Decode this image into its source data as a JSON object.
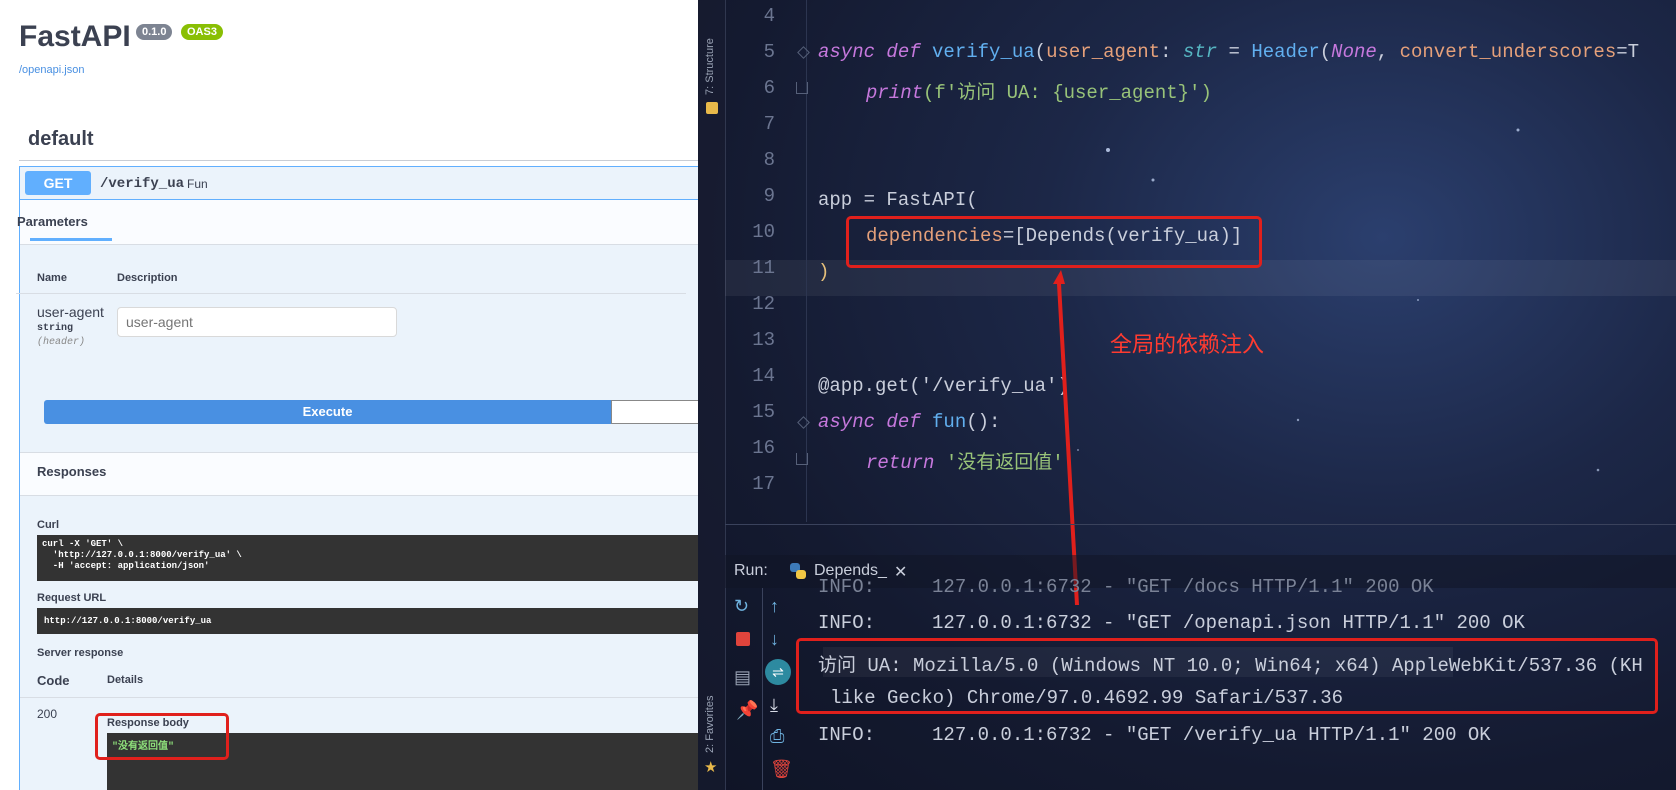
{
  "swagger": {
    "title": "FastAPI",
    "version_badge": "0.1.0",
    "oas_badge": "OAS3",
    "spec_link": "/openapi.json",
    "tag": "default",
    "operation": {
      "method": "GET",
      "path": "/verify_ua",
      "summary": "Fun"
    },
    "parameters_tab": "Parameters",
    "col_name": "Name",
    "col_description": "Description",
    "param": {
      "name": "user-agent",
      "type": "string",
      "in": "(header)",
      "placeholder": "user-agent"
    },
    "execute_label": "Execute",
    "responses_title": "Responses",
    "curl_label": "Curl",
    "curl_command": "curl -X 'GET' \\\n  'http://127.0.0.1:8000/verify_ua' \\\n  -H 'accept: application/json'",
    "request_url_label": "Request URL",
    "request_url": "http://127.0.0.1:8000/verify_ua",
    "server_response_label": "Server response",
    "code_header": "Code",
    "details_header": "Details",
    "status_code": "200",
    "response_body_label": "Response body",
    "response_body": "\"没有返回值\""
  },
  "ide": {
    "structure_label": "7: Structure",
    "favorites_label": "2: Favorites",
    "annotation": "全局的依赖注入",
    "code_lines": [
      {
        "n": "4"
      },
      {
        "n": "5"
      },
      {
        "n": "6"
      },
      {
        "n": "7"
      },
      {
        "n": "8"
      },
      {
        "n": "9"
      },
      {
        "n": "10"
      },
      {
        "n": "11"
      },
      {
        "n": "12"
      },
      {
        "n": "13"
      },
      {
        "n": "14"
      },
      {
        "n": "15"
      },
      {
        "n": "16"
      },
      {
        "n": "17"
      }
    ],
    "code": {
      "l5_async": "async def",
      "l5_fn": "verify_ua",
      "l5_open": "(",
      "l5_param": "user_agent",
      "l5_colon": ": ",
      "l5_type": "str",
      "l5_eq": " = ",
      "l5_header": "Header",
      "l5_paren": "(",
      "l5_none": "None",
      "l5_comma": ", ",
      "l5_conv": "convert_underscores",
      "l5_tail": "=T",
      "l6_print": "print",
      "l6_str": "(f'访问 UA: {user_agent}')",
      "l9": "app = FastAPI(",
      "l10_dep": "dependencies",
      "l10_rest": "=[Depends(verify_ua)]",
      "l11": ")",
      "l14": "@app.get('/verify_ua')",
      "l15_async": "async def",
      "l15_fn": "fun",
      "l15_rest": "():",
      "l16_return": "return",
      "l16_str": "'没有返回值'"
    },
    "run": {
      "label": "Run:",
      "tab": "Depends_",
      "close": "✕",
      "log0": "INFO:     127.0.0.1:6732 - \"GET /docs HTTP/1.1\" 200 OK",
      "log1": "INFO:     127.0.0.1:6732 - \"GET /openapi.json HTTP/1.1\" 200 OK",
      "log2": "访问 UA: Mozilla/5.0 (Windows NT 10.0; Win64; x64) AppleWebKit/537.36 (KH",
      "log3": "like Gecko) Chrome/97.0.4692.99 Safari/537.36",
      "log4": "INFO:     127.0.0.1:6732 - \"GET /verify_ua HTTP/1.1\" 200 OK"
    }
  }
}
